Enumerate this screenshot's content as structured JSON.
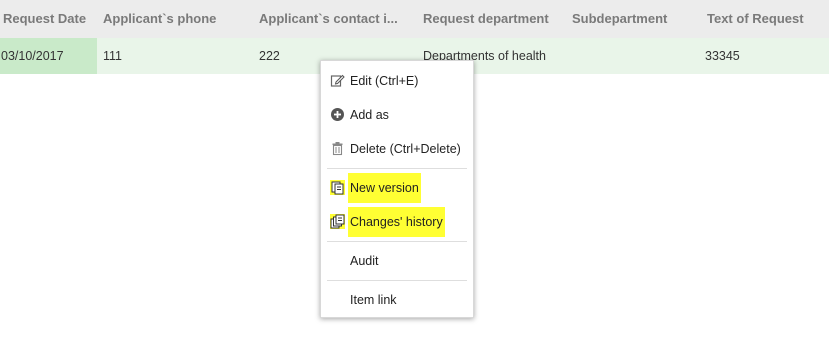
{
  "grid": {
    "columns": [
      "Request Date",
      "Applicant`s phone",
      "Applicant`s contact i...",
      "Request department",
      "Subdepartment",
      "Text of Request"
    ],
    "row": [
      "03/10/2017",
      "111",
      "222",
      "Departments of health",
      "",
      "33345"
    ]
  },
  "context_menu": {
    "items": [
      {
        "label": "Edit (Ctrl+E)",
        "icon": "edit-icon"
      },
      {
        "label": "Add as",
        "icon": "plus-circle-icon"
      },
      {
        "label": "Delete (Ctrl+Delete)",
        "icon": "trash-icon"
      },
      {
        "label": "New version",
        "icon": "new-version-icon",
        "highlighted": true
      },
      {
        "label": "Changes' history",
        "icon": "history-icon",
        "highlighted": true
      },
      {
        "label": "Audit"
      },
      {
        "label": "Item link"
      }
    ]
  },
  "colors": {
    "header_bg": "#ececec",
    "row_bg": "#e9f5e9",
    "selected_cell_bg": "#c9eac9",
    "highlight": "#ffff33"
  }
}
